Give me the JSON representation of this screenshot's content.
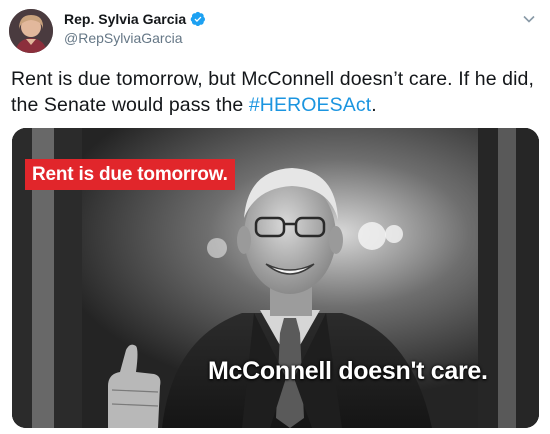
{
  "author": {
    "display_name": "Rep. Sylvia Garcia",
    "handle": "@RepSylviaGarcia",
    "verified": true,
    "avatar": "profile-photo"
  },
  "tweet": {
    "text_before": "Rent is due tomorrow, but McConnell doesn’t care. If he did, the Senate would pass the ",
    "hashtag": "#HEROESAct",
    "text_after": "."
  },
  "media": {
    "type": "photo",
    "caption_top": "Rent is due tomorrow.",
    "caption_bottom": "McConnell doesn't care."
  },
  "icons": {
    "verified": "verified-badge-icon",
    "menu": "chevron-down-icon"
  },
  "colors": {
    "link": "#1b95e0",
    "verified": "#1da1f2",
    "caption_background": "#e1262b",
    "handle": "#657786"
  }
}
